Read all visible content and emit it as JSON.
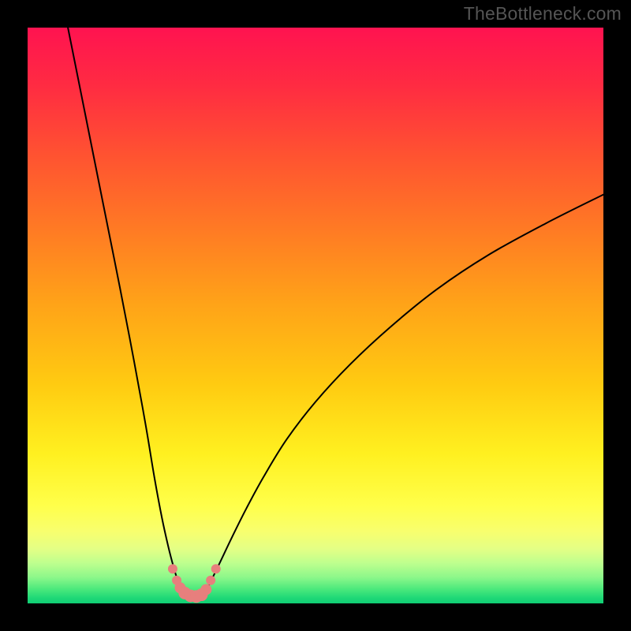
{
  "watermark": "TheBottleneck.com",
  "gradient": {
    "stops": [
      {
        "offset": 0.0,
        "color": "#ff1350"
      },
      {
        "offset": 0.1,
        "color": "#ff2b42"
      },
      {
        "offset": 0.22,
        "color": "#ff5231"
      },
      {
        "offset": 0.35,
        "color": "#ff7a24"
      },
      {
        "offset": 0.48,
        "color": "#ffa318"
      },
      {
        "offset": 0.62,
        "color": "#ffcb11"
      },
      {
        "offset": 0.74,
        "color": "#fff020"
      },
      {
        "offset": 0.83,
        "color": "#ffff4a"
      },
      {
        "offset": 0.875,
        "color": "#f8ff6e"
      },
      {
        "offset": 0.905,
        "color": "#e4ff85"
      },
      {
        "offset": 0.93,
        "color": "#beff8e"
      },
      {
        "offset": 0.955,
        "color": "#8cf78a"
      },
      {
        "offset": 0.975,
        "color": "#4ce97c"
      },
      {
        "offset": 0.99,
        "color": "#20d977"
      },
      {
        "offset": 1.0,
        "color": "#0fce74"
      }
    ]
  },
  "chart_data": {
    "type": "line",
    "title": "",
    "xlabel": "",
    "ylabel": "",
    "xlim": [
      0,
      100
    ],
    "ylim": [
      0,
      100
    ],
    "grid": false,
    "series": [
      {
        "name": "left-branch",
        "x": [
          7,
          10,
          13,
          16,
          18.5,
          20.5,
          22,
          23.3,
          24.4,
          25.3,
          26,
          26.6,
          27.3,
          28.2
        ],
        "y": [
          100,
          85,
          70,
          55,
          42,
          31,
          22,
          15,
          10,
          6.5,
          4.2,
          2.8,
          1.8,
          1.2
        ]
      },
      {
        "name": "right-branch",
        "x": [
          30.2,
          31,
          32,
          33.5,
          35.5,
          38,
          41,
          45,
          50,
          56,
          63,
          71,
          80,
          90,
          100
        ],
        "y": [
          1.2,
          2.2,
          4.2,
          7.3,
          11.5,
          16.5,
          22,
          28.5,
          35,
          41.5,
          48,
          54.5,
          60.5,
          66,
          71
        ]
      }
    ],
    "markers": {
      "name": "bottom-points",
      "color": "#e77f7d",
      "points": [
        {
          "x": 25.2,
          "y": 6.0,
          "r": 6
        },
        {
          "x": 25.9,
          "y": 4.0,
          "r": 6
        },
        {
          "x": 26.5,
          "y": 2.7,
          "r": 7
        },
        {
          "x": 27.3,
          "y": 1.8,
          "r": 8
        },
        {
          "x": 28.3,
          "y": 1.3,
          "r": 8
        },
        {
          "x": 29.3,
          "y": 1.2,
          "r": 8
        },
        {
          "x": 30.2,
          "y": 1.5,
          "r": 8
        },
        {
          "x": 31.0,
          "y": 2.4,
          "r": 7
        },
        {
          "x": 31.8,
          "y": 4.0,
          "r": 6
        },
        {
          "x": 32.7,
          "y": 6.0,
          "r": 6
        }
      ]
    }
  }
}
